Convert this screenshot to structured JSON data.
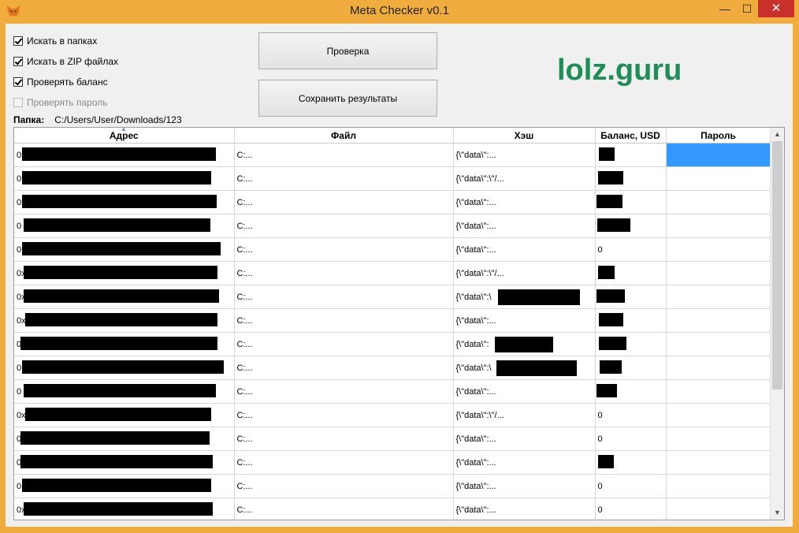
{
  "window": {
    "title": "Meta Checker v0.1",
    "minimize": "—",
    "maximize": "☐",
    "close": "✕"
  },
  "options": [
    {
      "label": "Искать в папках",
      "checked": true,
      "enabled": true
    },
    {
      "label": "Искать в ZIP файлах",
      "checked": true,
      "enabled": true
    },
    {
      "label": "Проверять баланс",
      "checked": true,
      "enabled": true
    },
    {
      "label": "Проверять пароль",
      "checked": false,
      "enabled": false
    }
  ],
  "buttons": {
    "check": "Проверка",
    "save": "Сохранить результаты"
  },
  "logo": "lolz.guru",
  "folder": {
    "label": "Папка:",
    "path": "C:/Users/User/Downloads/123"
  },
  "table": {
    "columns": [
      "Адрес",
      "Файл",
      "Хэш",
      "Баланс, USD",
      "Пароль"
    ],
    "rows": [
      {
        "address": "0x",
        "file": "C:...",
        "hash": "{\\\"data\\\":...",
        "balance": ""
      },
      {
        "address": "0x",
        "file": "C:...",
        "hash": "{\\\"data\\\":\\\"/...",
        "balance": ""
      },
      {
        "address": "0x",
        "file": "C:...",
        "hash": "{\\\"data\\\":...",
        "balance": ""
      },
      {
        "address": "0",
        "file": "C:...",
        "hash": "{\\\"data\\\":...",
        "balance": ""
      },
      {
        "address": "0",
        "file": "C:...",
        "hash": "{\\\"data\\\":...",
        "balance": "0"
      },
      {
        "address": "0x",
        "file": "C:...",
        "hash": "{\\\"data\\\":\\\"/...",
        "balance": ""
      },
      {
        "address": "0x",
        "file": "C:...",
        "hash": "{\\\"data\\\":\\",
        "balance": ""
      },
      {
        "address": "0x",
        "file": "C:...",
        "hash": "{\\\"data\\\":...",
        "balance": ""
      },
      {
        "address": "0",
        "file": "C:...",
        "hash": "{\\\"data\\\":",
        "balance": ""
      },
      {
        "address": "0",
        "file": "C:...",
        "hash": "{\\\"data\\\":\\",
        "balance": ""
      },
      {
        "address": "0",
        "file": "C:...",
        "hash": "{\\\"data\\\":...",
        "balance": ""
      },
      {
        "address": "0x",
        "file": "C:...",
        "hash": "{\\\"data\\\":\\\"/...",
        "balance": "0"
      },
      {
        "address": "0",
        "file": "C:...",
        "hash": "{\\\"data\\\":...",
        "balance": "0"
      },
      {
        "address": "0",
        "file": "C:...",
        "hash": "{\\\"data\\\":...",
        "balance": ""
      },
      {
        "address": "0",
        "file": "C:...",
        "hash": "{\\\"data\\\":...",
        "balance": "0"
      },
      {
        "address": "0x",
        "file": "C:...",
        "hash": "{\\\"data\\\":...",
        "balance": "0"
      }
    ]
  },
  "colors": {
    "titlebar": "#f0ad3e",
    "logo": "#1e8e57",
    "selection": "#3399ff",
    "close": "#c7302b"
  }
}
